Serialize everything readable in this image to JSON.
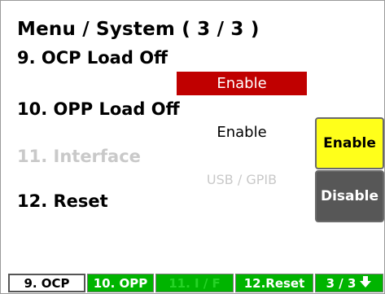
{
  "title": "Menu / System ( 3 / 3 )",
  "items": [
    {
      "label": "9. OCP Load Off",
      "value": "Enable",
      "value_selected": true,
      "enabled": true
    },
    {
      "label": "10. OPP Load Off",
      "value": "Enable",
      "value_selected": false,
      "enabled": true
    },
    {
      "label": "11.  Interface",
      "value": "USB / GPIB",
      "value_selected": false,
      "enabled": false
    },
    {
      "label": "12. Reset",
      "enabled": true
    }
  ],
  "side_buttons": {
    "enable": "Enable",
    "disable": "Disable"
  },
  "softkeys": [
    {
      "label": "9. OCP",
      "state": "active"
    },
    {
      "label": "10. OPP",
      "state": "normal"
    },
    {
      "label": "11. I / F",
      "state": "disabled"
    },
    {
      "label": "12.Reset",
      "state": "normal"
    },
    {
      "label": "3 / 3",
      "state": "normal",
      "icon": "arrow-down-icon"
    }
  ],
  "colors": {
    "selected_value_bg": "#c00000",
    "enable_button": "#ffff1a",
    "disable_button": "#575757",
    "softkey_green": "#00b400",
    "disabled_text": "#c9c9c9"
  }
}
